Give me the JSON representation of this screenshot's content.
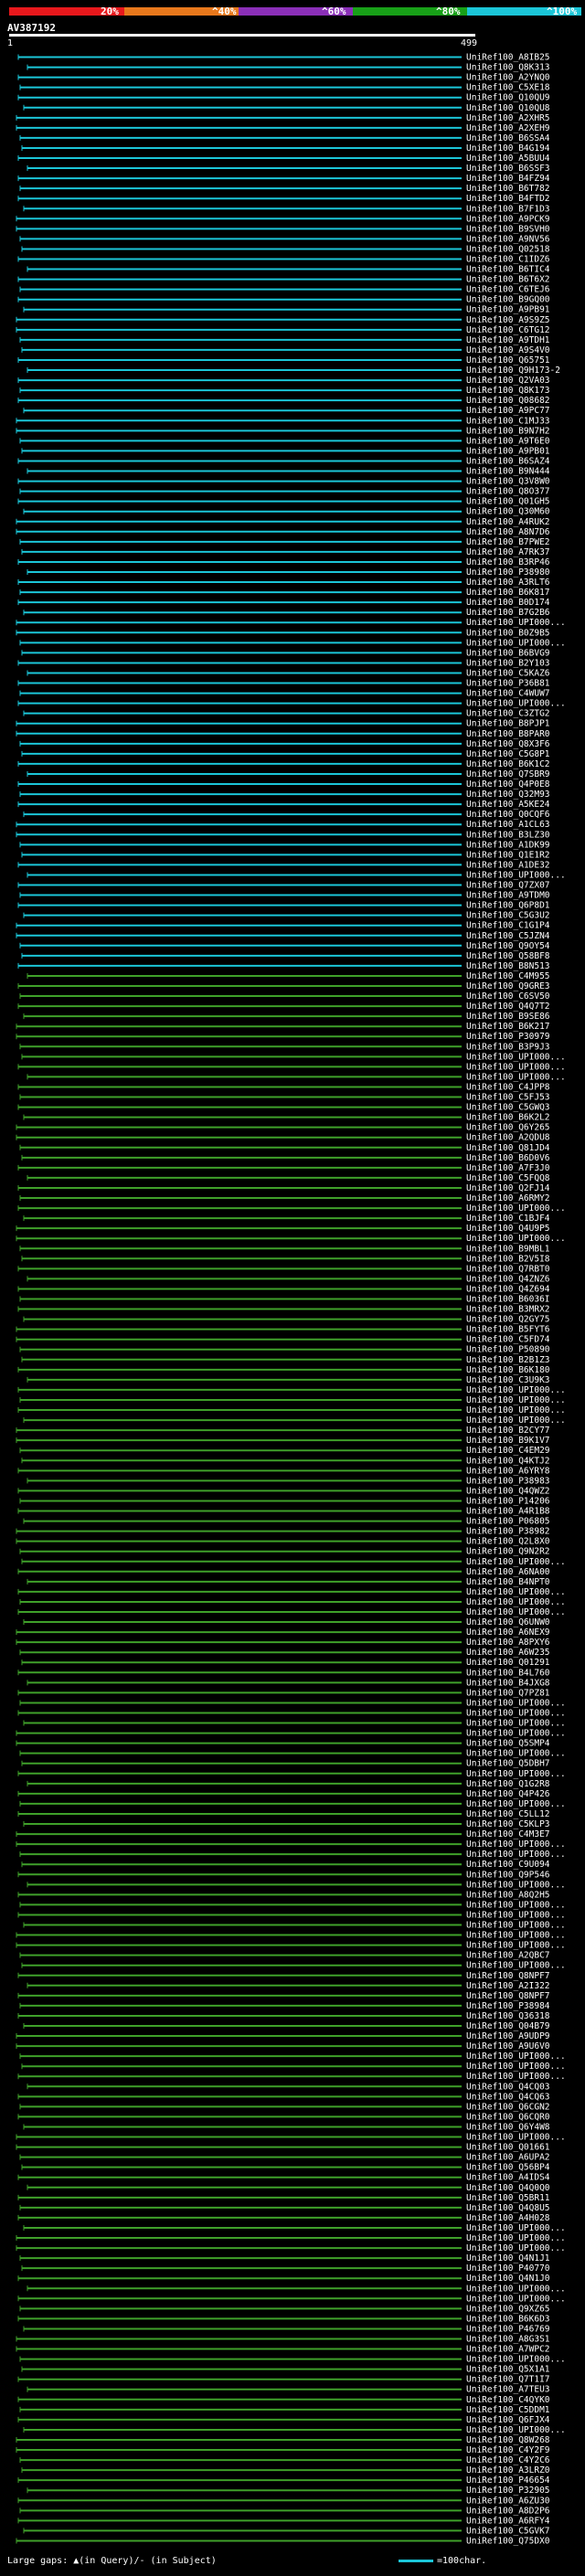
{
  "header": {
    "percent_ticks": [
      "20%",
      "^40%",
      "^60%",
      "^80%",
      "^100%"
    ],
    "colors": [
      "#e8181c",
      "#e8781c",
      "#8b2fb8",
      "#18a018",
      "#1bc6d8"
    ],
    "query_id": "AV387192",
    "scale_start": "1",
    "scale_end": "499"
  },
  "footer": {
    "large_gaps": "Large gaps: ▲(in Query)/- (in Subject)",
    "legend": "=100char."
  },
  "hit_colors": {
    "cyan": "#1bc6d8",
    "green": "#3fa02a"
  },
  "hits": [
    {
      "label": "UniRef100_A8IB25",
      "color": "cyan"
    },
    {
      "label": "UniRef100_Q8K313",
      "color": "cyan"
    },
    {
      "label": "UniRef100_A2YNQ0",
      "color": "cyan"
    },
    {
      "label": "UniRef100_C5XE18",
      "color": "cyan"
    },
    {
      "label": "UniRef100_Q10QU9",
      "color": "cyan"
    },
    {
      "label": "UniRef100_Q10QU8",
      "color": "cyan"
    },
    {
      "label": "UniRef100_A2XHR5",
      "color": "cyan"
    },
    {
      "label": "UniRef100_A2XEH9",
      "color": "cyan"
    },
    {
      "label": "UniRef100_B6SSA4",
      "color": "cyan"
    },
    {
      "label": "UniRef100_B4G194",
      "color": "cyan"
    },
    {
      "label": "UniRef100_A5BUU4",
      "color": "cyan"
    },
    {
      "label": "UniRef100_B6SSF3",
      "color": "cyan"
    },
    {
      "label": "UniRef100_B4FZ94",
      "color": "cyan"
    },
    {
      "label": "UniRef100_B6T782",
      "color": "cyan"
    },
    {
      "label": "UniRef100_B4FTD2",
      "color": "cyan"
    },
    {
      "label": "UniRef100_B7F1D3",
      "color": "cyan"
    },
    {
      "label": "UniRef100_A9PCK9",
      "color": "cyan"
    },
    {
      "label": "UniRef100_B9SVH0",
      "color": "cyan"
    },
    {
      "label": "UniRef100_A9NV56",
      "color": "cyan"
    },
    {
      "label": "UniRef100_Q02518",
      "color": "cyan"
    },
    {
      "label": "UniRef100_C1IDZ6",
      "color": "cyan"
    },
    {
      "label": "UniRef100_B6TIC4",
      "color": "cyan"
    },
    {
      "label": "UniRef100_B6T6X2",
      "color": "cyan"
    },
    {
      "label": "UniRef100_C6TEJ6",
      "color": "cyan"
    },
    {
      "label": "UniRef100_B9GQ00",
      "color": "cyan"
    },
    {
      "label": "UniRef100_A9PB91",
      "color": "cyan"
    },
    {
      "label": "UniRef100_A9S9Z5",
      "color": "cyan"
    },
    {
      "label": "UniRef100_C6TG12",
      "color": "cyan"
    },
    {
      "label": "UniRef100_A9TDH1",
      "color": "cyan"
    },
    {
      "label": "UniRef100_A9S4V0",
      "color": "cyan"
    },
    {
      "label": "UniRef100_Q65751",
      "color": "cyan"
    },
    {
      "label": "UniRef100_Q9H173-2",
      "color": "cyan"
    },
    {
      "label": "UniRef100_Q2VA03",
      "color": "cyan"
    },
    {
      "label": "UniRef100_Q8K173",
      "color": "cyan"
    },
    {
      "label": "UniRef100_Q08682",
      "color": "cyan"
    },
    {
      "label": "UniRef100_A9PC77",
      "color": "cyan"
    },
    {
      "label": "UniRef100_C1MJ33",
      "color": "cyan"
    },
    {
      "label": "UniRef100_B9N7H2",
      "color": "cyan"
    },
    {
      "label": "UniRef100_A9T6E0",
      "color": "cyan"
    },
    {
      "label": "UniRef100_A9PB01",
      "color": "cyan"
    },
    {
      "label": "UniRef100_B6SAZ4",
      "color": "cyan"
    },
    {
      "label": "UniRef100_B9N444",
      "color": "cyan"
    },
    {
      "label": "UniRef100_Q3V8W0",
      "color": "cyan"
    },
    {
      "label": "UniRef100_Q8O377",
      "color": "cyan"
    },
    {
      "label": "UniRef100_Q01GH5",
      "color": "cyan"
    },
    {
      "label": "UniRef100_Q30M60",
      "color": "cyan"
    },
    {
      "label": "UniRef100_A4RUK2",
      "color": "cyan"
    },
    {
      "label": "UniRef100_A8N7D6",
      "color": "cyan"
    },
    {
      "label": "UniRef100_B7PWE2",
      "color": "cyan"
    },
    {
      "label": "UniRef100_A7RK37",
      "color": "cyan"
    },
    {
      "label": "UniRef100_B3RP46",
      "color": "cyan"
    },
    {
      "label": "UniRef100_P38980",
      "color": "cyan"
    },
    {
      "label": "UniRef100_A3RLT6",
      "color": "cyan"
    },
    {
      "label": "UniRef100_B6K817",
      "color": "cyan"
    },
    {
      "label": "UniRef100_B0D174",
      "color": "cyan"
    },
    {
      "label": "UniRef100_B7G2B6",
      "color": "cyan"
    },
    {
      "label": "UniRef100_UPI000...",
      "color": "cyan"
    },
    {
      "label": "UniRef100_B0Z9B5",
      "color": "cyan"
    },
    {
      "label": "UniRef100_UPI000...",
      "color": "cyan"
    },
    {
      "label": "UniRef100_B6BVG9",
      "color": "cyan"
    },
    {
      "label": "UniRef100_B2Y103",
      "color": "cyan"
    },
    {
      "label": "UniRef100_C5KAZ6",
      "color": "cyan"
    },
    {
      "label": "UniRef100_P36B81",
      "color": "cyan"
    },
    {
      "label": "UniRef100_C4WUW7",
      "color": "cyan"
    },
    {
      "label": "UniRef100_UPI000...",
      "color": "cyan"
    },
    {
      "label": "UniRef100_C3ZTG2",
      "color": "cyan"
    },
    {
      "label": "UniRef100_B8PJP1",
      "color": "cyan"
    },
    {
      "label": "UniRef100_B8PAR0",
      "color": "cyan"
    },
    {
      "label": "UniRef100_Q8X3F6",
      "color": "cyan"
    },
    {
      "label": "UniRef100_C5G8P1",
      "color": "cyan"
    },
    {
      "label": "UniRef100_B6K1C2",
      "color": "cyan"
    },
    {
      "label": "UniRef100_Q7SBR9",
      "color": "cyan"
    },
    {
      "label": "UniRef100_Q4P0E8",
      "color": "cyan"
    },
    {
      "label": "UniRef100_Q32M93",
      "color": "cyan"
    },
    {
      "label": "UniRef100_A5KE24",
      "color": "cyan"
    },
    {
      "label": "UniRef100_Q0CQF6",
      "color": "cyan"
    },
    {
      "label": "UniRef100_A1CL63",
      "color": "cyan"
    },
    {
      "label": "UniRef100_B3LZ30",
      "color": "cyan"
    },
    {
      "label": "UniRef100_A1DK99",
      "color": "cyan"
    },
    {
      "label": "UniRef100_Q1E1R2",
      "color": "cyan"
    },
    {
      "label": "UniRef100_A1DE32",
      "color": "cyan"
    },
    {
      "label": "UniRef100_UPI000...",
      "color": "cyan"
    },
    {
      "label": "UniRef100_Q7ZX07",
      "color": "cyan"
    },
    {
      "label": "UniRef100_A9TDM0",
      "color": "cyan"
    },
    {
      "label": "UniRef100_Q6P8D1",
      "color": "cyan"
    },
    {
      "label": "UniRef100_C5G3U2",
      "color": "cyan"
    },
    {
      "label": "UniRef100_C1G1P4",
      "color": "cyan"
    },
    {
      "label": "UniRef100_C5JZN4",
      "color": "cyan"
    },
    {
      "label": "UniRef100_Q9OY54",
      "color": "cyan"
    },
    {
      "label": "UniRef100_Q58BF8",
      "color": "cyan"
    },
    {
      "label": "UniRef100_B8N513",
      "color": "cyan"
    },
    {
      "label": "UniRef100_C4M955",
      "color": "green"
    },
    {
      "label": "UniRef100_Q9GRE3",
      "color": "green"
    },
    {
      "label": "UniRef100_C6SV50",
      "color": "green"
    },
    {
      "label": "UniRef100_Q4Q7T2",
      "color": "green"
    },
    {
      "label": "UniRef100_B9SE86",
      "color": "green"
    },
    {
      "label": "UniRef100_B6K217",
      "color": "green"
    },
    {
      "label": "UniRef100_P30979",
      "color": "green"
    },
    {
      "label": "UniRef100_B3P9J3",
      "color": "green"
    },
    {
      "label": "UniRef100_UPI000...",
      "color": "green"
    },
    {
      "label": "UniRef100_UPI000...",
      "color": "green"
    },
    {
      "label": "UniRef100_UPI000...",
      "color": "green"
    },
    {
      "label": "UniRef100_C4JPP8",
      "color": "green"
    },
    {
      "label": "UniRef100_C5FJ53",
      "color": "green"
    },
    {
      "label": "UniRef100_C5GWQ3",
      "color": "green"
    },
    {
      "label": "UniRef100_B6K2L2",
      "color": "green"
    },
    {
      "label": "UniRef100_Q6Y265",
      "color": "green"
    },
    {
      "label": "UniRef100_A2QDU8",
      "color": "green"
    },
    {
      "label": "UniRef100_Q81JD4",
      "color": "green"
    },
    {
      "label": "UniRef100_B6D0V6",
      "color": "green"
    },
    {
      "label": "UniRef100_A7F3J0",
      "color": "green"
    },
    {
      "label": "UniRef100_C5FQQ8",
      "color": "green"
    },
    {
      "label": "UniRef100_Q2FJ14",
      "color": "green"
    },
    {
      "label": "UniRef100_A6RMY2",
      "color": "green"
    },
    {
      "label": "UniRef100_UPI000...",
      "color": "green"
    },
    {
      "label": "UniRef100_C1BJF4",
      "color": "green"
    },
    {
      "label": "UniRef100_Q4U9P5",
      "color": "green"
    },
    {
      "label": "UniRef100_UPI000...",
      "color": "green"
    },
    {
      "label": "UniRef100_B9MBL1",
      "color": "green"
    },
    {
      "label": "UniRef100_B2V5I8",
      "color": "green"
    },
    {
      "label": "UniRef100_Q7RBT0",
      "color": "green"
    },
    {
      "label": "UniRef100_Q4ZNZ6",
      "color": "green"
    },
    {
      "label": "UniRef100_Q4Z694",
      "color": "green"
    },
    {
      "label": "UniRef100_B6036I",
      "color": "green"
    },
    {
      "label": "UniRef100_B3MRX2",
      "color": "green"
    },
    {
      "label": "UniRef100_Q2GY75",
      "color": "green"
    },
    {
      "label": "UniRef100_B5FYT6",
      "color": "green"
    },
    {
      "label": "UniRef100_C5FD74",
      "color": "green"
    },
    {
      "label": "UniRef100_P50890",
      "color": "green"
    },
    {
      "label": "UniRef100_B2B1Z3",
      "color": "green"
    },
    {
      "label": "UniRef100_B6K180",
      "color": "green"
    },
    {
      "label": "UniRef100_C3U9K3",
      "color": "green"
    },
    {
      "label": "UniRef100_UPI000...",
      "color": "green"
    },
    {
      "label": "UniRef100_UPI000...",
      "color": "green"
    },
    {
      "label": "UniRef100_UPI000...",
      "color": "green"
    },
    {
      "label": "UniRef100_UPI000...",
      "color": "green"
    },
    {
      "label": "UniRef100_B2CY77",
      "color": "green"
    },
    {
      "label": "UniRef100_B9K1V7",
      "color": "green"
    },
    {
      "label": "UniRef100_C4EM29",
      "color": "green"
    },
    {
      "label": "UniRef100_Q4KTJ2",
      "color": "green"
    },
    {
      "label": "UniRef100_A6YRY8",
      "color": "green"
    },
    {
      "label": "UniRef100_P38983",
      "color": "green"
    },
    {
      "label": "UniRef100_Q4QWZ2",
      "color": "green"
    },
    {
      "label": "UniRef100_P14206",
      "color": "green"
    },
    {
      "label": "UniRef100_A4R1B8",
      "color": "green"
    },
    {
      "label": "UniRef100_P06805",
      "color": "green"
    },
    {
      "label": "UniRef100_P38982",
      "color": "green"
    },
    {
      "label": "UniRef100_Q2L8X0",
      "color": "green"
    },
    {
      "label": "UniRef100_Q9N2R2",
      "color": "green"
    },
    {
      "label": "UniRef100_UPI000...",
      "color": "green"
    },
    {
      "label": "UniRef100_A6NA00",
      "color": "green"
    },
    {
      "label": "UniRef100_B4NPT0",
      "color": "green"
    },
    {
      "label": "UniRef100_UPI000...",
      "color": "green"
    },
    {
      "label": "UniRef100_UPI000...",
      "color": "green"
    },
    {
      "label": "UniRef100_UPI000...",
      "color": "green"
    },
    {
      "label": "UniRef100_Q6UNW0",
      "color": "green"
    },
    {
      "label": "UniRef100_A6NEX9",
      "color": "green"
    },
    {
      "label": "UniRef100_A8PXY6",
      "color": "green"
    },
    {
      "label": "UniRef100_A6W235",
      "color": "green"
    },
    {
      "label": "UniRef100_Q01291",
      "color": "green"
    },
    {
      "label": "UniRef100_B4L760",
      "color": "green"
    },
    {
      "label": "UniRef100_B4JXG8",
      "color": "green"
    },
    {
      "label": "UniRef100_Q7PZ81",
      "color": "green"
    },
    {
      "label": "UniRef100_UPI000...",
      "color": "green"
    },
    {
      "label": "UniRef100_UPI000...",
      "color": "green"
    },
    {
      "label": "UniRef100_UPI000...",
      "color": "green"
    },
    {
      "label": "UniRef100_UPI000...",
      "color": "green"
    },
    {
      "label": "UniRef100_Q5SMP4",
      "color": "green"
    },
    {
      "label": "UniRef100_UPI000...",
      "color": "green"
    },
    {
      "label": "UniRef100_Q5DBH7",
      "color": "green"
    },
    {
      "label": "UniRef100_UPI000...",
      "color": "green"
    },
    {
      "label": "UniRef100_Q1G2R8",
      "color": "green"
    },
    {
      "label": "UniRef100_Q4P426",
      "color": "green"
    },
    {
      "label": "UniRef100_UPI000...",
      "color": "green"
    },
    {
      "label": "UniRef100_C5LL12",
      "color": "green"
    },
    {
      "label": "UniRef100_C5KLP3",
      "color": "green"
    },
    {
      "label": "UniRef100_C4M3E7",
      "color": "green"
    },
    {
      "label": "UniRef100_UPI000...",
      "color": "green"
    },
    {
      "label": "UniRef100_UPI000...",
      "color": "green"
    },
    {
      "label": "UniRef100_C9U094",
      "color": "green"
    },
    {
      "label": "UniRef100_Q9P546",
      "color": "green"
    },
    {
      "label": "UniRef100_UPI000...",
      "color": "green"
    },
    {
      "label": "UniRef100_A8Q2H5",
      "color": "green"
    },
    {
      "label": "UniRef100_UPI000...",
      "color": "green"
    },
    {
      "label": "UniRef100_UPI000...",
      "color": "green"
    },
    {
      "label": "UniRef100_UPI000...",
      "color": "green"
    },
    {
      "label": "UniRef100_UPI000...",
      "color": "green"
    },
    {
      "label": "UniRef100_UPI000...",
      "color": "green"
    },
    {
      "label": "UniRef100_A2QBC7",
      "color": "green"
    },
    {
      "label": "UniRef100_UPI000...",
      "color": "green"
    },
    {
      "label": "UniRef100_Q8NPF7",
      "color": "green"
    },
    {
      "label": "UniRef100_A2I322",
      "color": "green"
    },
    {
      "label": "UniRef100_Q8NPF7",
      "color": "green"
    },
    {
      "label": "UniRef100_P38984",
      "color": "green"
    },
    {
      "label": "UniRef100_Q36318",
      "color": "green"
    },
    {
      "label": "UniRef100_Q04B79",
      "color": "green"
    },
    {
      "label": "UniRef100_A9UDP9",
      "color": "green"
    },
    {
      "label": "UniRef100_A9U6V0",
      "color": "green"
    },
    {
      "label": "UniRef100_UPI000...",
      "color": "green"
    },
    {
      "label": "UniRef100_UPI000...",
      "color": "green"
    },
    {
      "label": "UniRef100_UPI000...",
      "color": "green"
    },
    {
      "label": "UniRef100_Q4CQ03",
      "color": "green"
    },
    {
      "label": "UniRef100_Q4CQ63",
      "color": "green"
    },
    {
      "label": "UniRef100_Q6CGN2",
      "color": "green"
    },
    {
      "label": "UniRef100_Q6CQR0",
      "color": "green"
    },
    {
      "label": "UniRef100_Q6Y4W8",
      "color": "green"
    },
    {
      "label": "UniRef100_UPI000...",
      "color": "green"
    },
    {
      "label": "UniRef100_Q01661",
      "color": "green"
    },
    {
      "label": "UniRef100_A6UPA2",
      "color": "green"
    },
    {
      "label": "UniRef100_Q56BP4",
      "color": "green"
    },
    {
      "label": "UniRef100_A4IDS4",
      "color": "green"
    },
    {
      "label": "UniRef100_Q4Q0Q0",
      "color": "green"
    },
    {
      "label": "UniRef100_Q5BR11",
      "color": "green"
    },
    {
      "label": "UniRef100_Q4Q8U5",
      "color": "green"
    },
    {
      "label": "UniRef100_A4H028",
      "color": "green"
    },
    {
      "label": "UniRef100_UPI000...",
      "color": "green"
    },
    {
      "label": "UniRef100_UPI000...",
      "color": "green"
    },
    {
      "label": "UniRef100_UPI000...",
      "color": "green"
    },
    {
      "label": "UniRef100_Q4N1J1",
      "color": "green"
    },
    {
      "label": "UniRef100_P40770",
      "color": "green"
    },
    {
      "label": "UniRef100_Q4N1J0",
      "color": "green"
    },
    {
      "label": "UniRef100_UPI000...",
      "color": "green"
    },
    {
      "label": "UniRef100_UPI000...",
      "color": "green"
    },
    {
      "label": "UniRef100_Q9XZ65",
      "color": "green"
    },
    {
      "label": "UniRef100_B6K6D3",
      "color": "green"
    },
    {
      "label": "UniRef100_P46769",
      "color": "green"
    },
    {
      "label": "UniRef100_A8G3S1",
      "color": "green"
    },
    {
      "label": "UniRef100_A7WPC2",
      "color": "green"
    },
    {
      "label": "UniRef100_UPI000...",
      "color": "green"
    },
    {
      "label": "UniRef100_Q5X1A1",
      "color": "green"
    },
    {
      "label": "UniRef100_Q7T1I7",
      "color": "green"
    },
    {
      "label": "UniRef100_A7TEU3",
      "color": "green"
    },
    {
      "label": "UniRef100_C4QYK0",
      "color": "green"
    },
    {
      "label": "UniRef100_C5DDM1",
      "color": "green"
    },
    {
      "label": "UniRef100_Q6FJX4",
      "color": "green"
    },
    {
      "label": "UniRef100_UPI000...",
      "color": "green"
    },
    {
      "label": "UniRef100_Q8W268",
      "color": "green"
    },
    {
      "label": "UniRef100_C4Y2F9",
      "color": "green"
    },
    {
      "label": "UniRef100_C4Y2C6",
      "color": "green"
    },
    {
      "label": "UniRef100_A3LRZ0",
      "color": "green"
    },
    {
      "label": "UniRef100_P46654",
      "color": "green"
    },
    {
      "label": "UniRef100_P32905",
      "color": "green"
    },
    {
      "label": "UniRef100_A6ZU30",
      "color": "green"
    },
    {
      "label": "UniRef100_A8D2P6",
      "color": "green"
    },
    {
      "label": "UniRef100_A6RFY4",
      "color": "green"
    },
    {
      "label": "UniRef100_C5GVK7",
      "color": "green"
    },
    {
      "label": "UniRef100_Q75DX0",
      "color": "green"
    }
  ]
}
